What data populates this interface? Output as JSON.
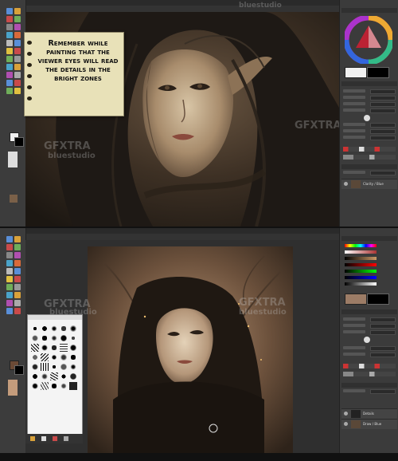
{
  "tip_note": {
    "text": "Remember while painting that the viewer eyes will read the details in the bright zones"
  },
  "watermarks": {
    "brand_a": "GFXTRA",
    "brand_b": "bluestudio"
  },
  "layers": {
    "top_layer_name": "Clarity / Blue",
    "bottom_layer_1": "Details",
    "bottom_layer_2": "Draw / Blue"
  },
  "colors": {
    "ui_dark": "#3a3a3a",
    "note_paper": "#e8e1b8",
    "fg_color": "#f0f0f0",
    "bg_color": "#000000"
  },
  "icons": [
    "color-wheel-icon",
    "eye-icon",
    "brush-icon",
    "tool-icon"
  ]
}
